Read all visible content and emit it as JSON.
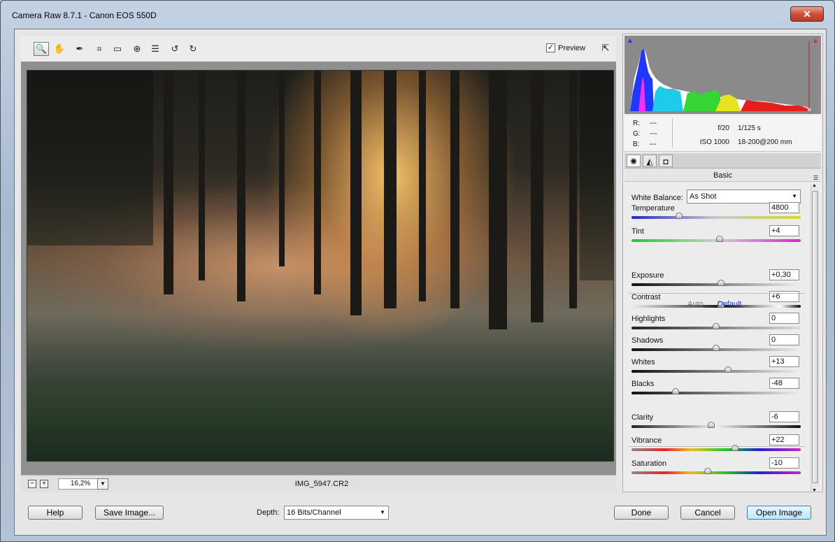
{
  "window": {
    "title": "Camera Raw 8.7.1  -  Canon EOS 550D",
    "close_label": "✕"
  },
  "toolbar": {
    "tools": [
      {
        "name": "zoom-tool",
        "icon": "magnifier-icon",
        "glyph": "🔍"
      },
      {
        "name": "hand-tool",
        "icon": "hand-icon",
        "glyph": "✋"
      },
      {
        "name": "white-balance-tool",
        "icon": "eyedropper-icon",
        "glyph": "✒"
      },
      {
        "name": "crop-tool",
        "icon": "crop-icon",
        "glyph": "⌗"
      },
      {
        "name": "straighten-tool",
        "icon": "level-icon",
        "glyph": "▭"
      },
      {
        "name": "red-eye-tool",
        "icon": "red-eye-icon",
        "glyph": "⊕"
      },
      {
        "name": "preferences-tool",
        "icon": "list-icon",
        "glyph": "☰"
      },
      {
        "name": "rotate-ccw-tool",
        "icon": "rotate-left-icon",
        "glyph": "↺"
      },
      {
        "name": "rotate-cw-tool",
        "icon": "rotate-right-icon",
        "glyph": "↻"
      }
    ],
    "preview_label": "Preview",
    "preview_checked": true,
    "fullscreen_icon": "fullscreen-icon"
  },
  "status": {
    "zoom_value": "16,2%",
    "filename": "IMG_5947.CR2"
  },
  "info": {
    "r_label": "R:",
    "r_value": "---",
    "g_label": "G:",
    "g_value": "---",
    "b_label": "B:",
    "b_value": "---",
    "aperture": "f/20",
    "shutter": "1/125 s",
    "iso": "ISO 1000",
    "lens": "18-200@200 mm"
  },
  "panel": {
    "section_title": "Basic",
    "white_balance_label": "White Balance:",
    "white_balance_value": "As Shot",
    "auto_label": "Auto",
    "default_label": "Default",
    "sliders": [
      {
        "label": "Temperature",
        "value": "4800",
        "position": 0.28
      },
      {
        "label": "Tint",
        "value": "+4",
        "position": 0.52
      },
      {
        "label": "Exposure",
        "value": "+0,30",
        "position": 0.53
      },
      {
        "label": "Contrast",
        "value": "+6",
        "position": 0.53
      },
      {
        "label": "Highlights",
        "value": "0",
        "position": 0.5
      },
      {
        "label": "Shadows",
        "value": "0",
        "position": 0.5
      },
      {
        "label": "Whites",
        "value": "+13",
        "position": 0.57
      },
      {
        "label": "Blacks",
        "value": "-48",
        "position": 0.26
      },
      {
        "label": "Clarity",
        "value": "-6",
        "position": 0.47
      },
      {
        "label": "Vibrance",
        "value": "+22",
        "position": 0.61
      },
      {
        "label": "Saturation",
        "value": "-10",
        "position": 0.45
      }
    ]
  },
  "footer": {
    "help_label": "Help",
    "save_label": "Save Image...",
    "depth_label": "Depth:",
    "depth_value": "16 Bits/Channel",
    "done_label": "Done",
    "cancel_label": "Cancel",
    "open_label": "Open Image"
  }
}
